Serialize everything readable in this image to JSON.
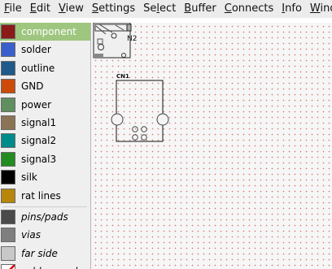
{
  "menubar": {
    "items": [
      {
        "pre": "",
        "u": "F",
        "post": "ile"
      },
      {
        "pre": "",
        "u": "E",
        "post": "dit"
      },
      {
        "pre": "",
        "u": "V",
        "post": "iew"
      },
      {
        "pre": "",
        "u": "S",
        "post": "ettings"
      },
      {
        "pre": "Se",
        "u": "l",
        "post": "ect"
      },
      {
        "pre": "",
        "u": "B",
        "post": "uffer"
      },
      {
        "pre": "",
        "u": "C",
        "post": "onnects"
      },
      {
        "pre": "",
        "u": "I",
        "post": "nfo"
      },
      {
        "pre": "",
        "u": "W",
        "post": "indo"
      }
    ]
  },
  "layers": {
    "items": [
      {
        "label": "component",
        "color": "#8b1a1a",
        "active": true
      },
      {
        "label": "solder",
        "color": "#3a5fcd"
      },
      {
        "label": "outline",
        "color": "#1f5a8a"
      },
      {
        "label": "GND",
        "color": "#cd4a0a"
      },
      {
        "label": "power",
        "color": "#5f8f5f"
      },
      {
        "label": "signal1",
        "color": "#8b7355"
      },
      {
        "label": "signal2",
        "color": "#008b8b"
      },
      {
        "label": "signal3",
        "color": "#228b22"
      },
      {
        "label": "silk",
        "color": "#000000"
      },
      {
        "label": "rat lines",
        "color": "#b8860b"
      }
    ],
    "special": [
      {
        "label": "pins/pads",
        "color": "#4a4a4a"
      },
      {
        "label": "vias",
        "color": "#7f7f7f"
      },
      {
        "label": "far side",
        "color": "#c8c8c8"
      },
      {
        "label": "solder mask",
        "color": "#ffffff"
      }
    ]
  },
  "canvas": {
    "component_label": "CN1",
    "partial_label": "N2"
  }
}
